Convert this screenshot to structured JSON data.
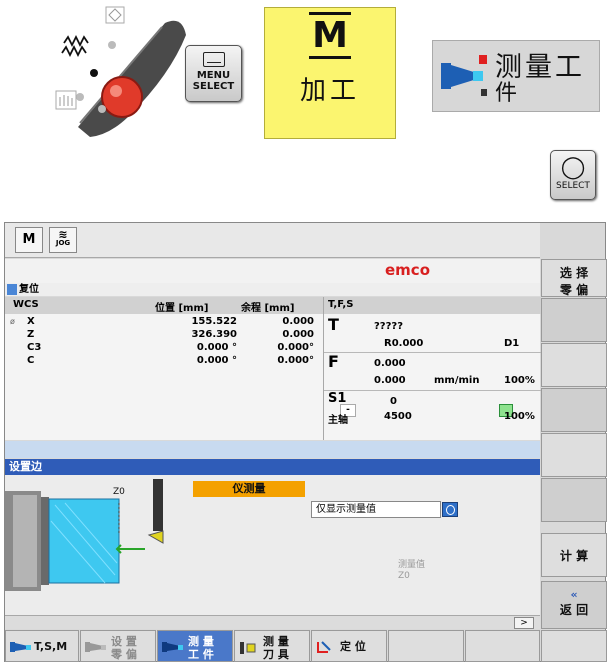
{
  "keys": {
    "menu_select": {
      "line1": "MENU",
      "line2": "SELECT"
    },
    "machining": {
      "letter": "M",
      "label": "加工"
    },
    "measure_workpiece": {
      "line1": "测量工",
      "line2": "件"
    },
    "select": {
      "glyph": "◯",
      "label": "SELECT"
    }
  },
  "screen": {
    "mode_buttons": [
      {
        "label": "M"
      },
      {
        "label": "JOG"
      }
    ],
    "brand": "emco",
    "status": "复位",
    "wcs": {
      "headers": [
        "WCS",
        "位置 [mm]",
        "余程 [mm]"
      ],
      "rows": [
        {
          "axis": "X",
          "position": "155.522",
          "remaining": "0.000"
        },
        {
          "axis": "Z",
          "position": "326.390",
          "remaining": "0.000"
        },
        {
          "axis": "C3",
          "position": "0.000 °",
          "remaining": "0.000°"
        },
        {
          "axis": "C",
          "position": "0.000 °",
          "remaining": "0.000°"
        }
      ]
    },
    "tfs": {
      "header": "T,F,S",
      "t_label": "T",
      "tool": "?????",
      "radius": "R0.000",
      "d": "D1",
      "f_label": "F",
      "feed_actual": "0.000",
      "feed_set": "0.000",
      "feed_unit": "mm/min",
      "feed_pct": "100%",
      "s_label": "S1",
      "s_value": "0",
      "spindle_label": "主轴",
      "spindle_speed": "4500",
      "spindle_pct": "100%"
    },
    "title": "设置边",
    "measure_label": "仪测量",
    "measure_field": "仅显示测量值",
    "measured_value_label": "测量值",
    "z0_faint": "Z0",
    "z0_label": "Z0",
    "scroll_label": ">"
  },
  "vertical_softkeys": [
    {
      "line1": "选 择",
      "line2": "零 偏"
    },
    {
      "line1": "",
      "line2": ""
    },
    {
      "line1": "",
      "line2": ""
    },
    {
      "line1": "",
      "line2": ""
    },
    {
      "line1": "",
      "line2": ""
    },
    {
      "line1": "",
      "line2": ""
    },
    {
      "line1": "计 算",
      "line2": ""
    },
    {
      "line1": "«",
      "line2": "返 回"
    }
  ],
  "horizontal_softkeys": [
    {
      "line1": "T,S,M",
      "line2": ""
    },
    {
      "line1": "设 置",
      "line2": "零 偏"
    },
    {
      "line1": "测 量",
      "line2": "工 件"
    },
    {
      "line1": "测 量",
      "line2": "刀 具"
    },
    {
      "line1": "定 位",
      "line2": ""
    },
    {
      "line1": "",
      "line2": ""
    },
    {
      "line1": "",
      "line2": ""
    }
  ],
  "colors": {
    "accent_yellow": "#fbf56f",
    "title_blue": "#2f5cb8",
    "brand_red": "#d81f1f",
    "measure_orange": "#f4a100",
    "workpiece_cyan": "#3ec8f0"
  }
}
